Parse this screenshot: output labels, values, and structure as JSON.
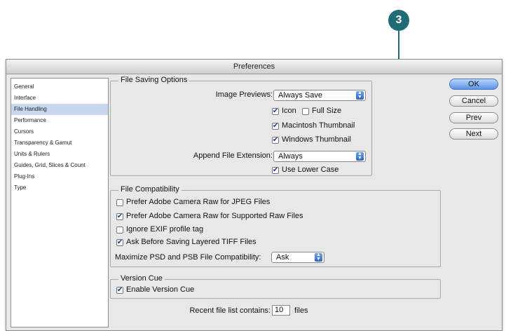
{
  "callout": {
    "number": "3"
  },
  "window": {
    "title": "Preferences"
  },
  "sidebar": {
    "items": [
      {
        "label": "General"
      },
      {
        "label": "Interface"
      },
      {
        "label": "File Handling"
      },
      {
        "label": "Performance"
      },
      {
        "label": "Cursors"
      },
      {
        "label": "Transparency & Gamut"
      },
      {
        "label": "Units & Rulers"
      },
      {
        "label": "Guides, Grid, Slices & Count"
      },
      {
        "label": "Plug-Ins"
      },
      {
        "label": "Type"
      }
    ],
    "selected": "File Handling"
  },
  "file_saving": {
    "title": "File Saving Options",
    "image_previews_label": "Image Previews:",
    "image_previews_value": "Always Save",
    "icon_label": "Icon",
    "icon_checked": true,
    "full_size_label": "Full Size",
    "full_size_checked": false,
    "mac_thumb_label": "Macintosh Thumbnail",
    "mac_thumb_checked": true,
    "win_thumb_label": "Windows Thumbnail",
    "win_thumb_checked": true,
    "append_ext_label": "Append File Extension:",
    "append_ext_value": "Always",
    "lower_case_label": "Use Lower Case",
    "lower_case_checked": true
  },
  "file_compat": {
    "title": "File Compatibility",
    "opt1_label": "Prefer Adobe Camera Raw for JPEG Files",
    "opt1_checked": false,
    "opt2_label": "Prefer Adobe Camera Raw for Supported Raw Files",
    "opt2_checked": true,
    "opt3_label": "Ignore EXIF profile tag",
    "opt3_checked": false,
    "opt4_label": "Ask Before Saving Layered TIFF Files",
    "opt4_checked": true,
    "maximize_label": "Maximize PSD and PSB File Compatibility:",
    "maximize_value": "Ask"
  },
  "version_cue": {
    "title": "Version Cue",
    "enable_label": "Enable Version Cue",
    "enable_checked": true
  },
  "recent": {
    "label": "Recent file list contains:",
    "value": "10",
    "suffix": "files"
  },
  "buttons": {
    "ok": "OK",
    "cancel": "Cancel",
    "prev": "Prev",
    "next": "Next"
  },
  "colors": {
    "callout": "#1f6b76",
    "selection": "#c6d6ec",
    "primary_button": "#5b93e6"
  }
}
